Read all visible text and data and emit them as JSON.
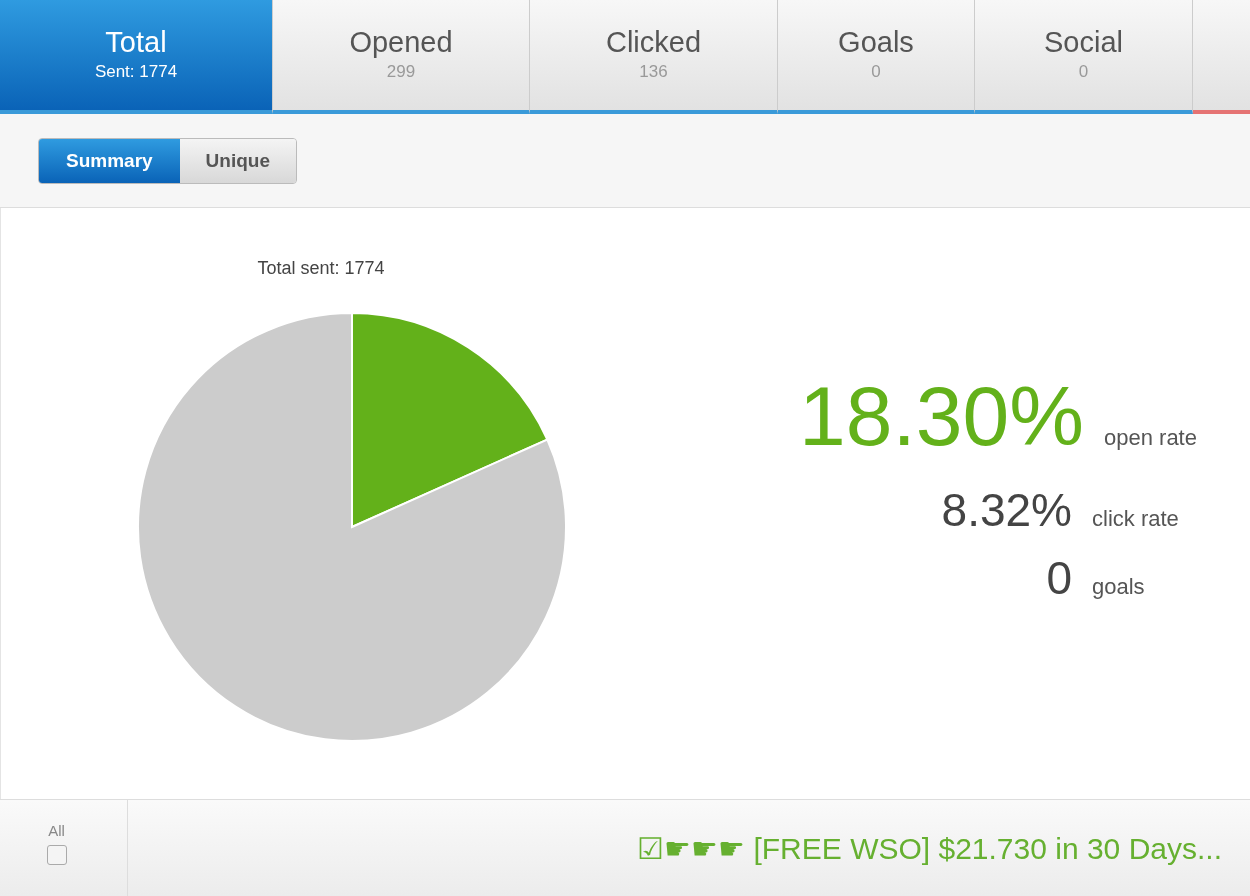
{
  "tabs": [
    {
      "label": "Total",
      "count": "Sent: 1774",
      "selected": true,
      "color": "#3a9ad9"
    },
    {
      "label": "Opened",
      "count": "299",
      "selected": false,
      "color": "#3a9ad9"
    },
    {
      "label": "Clicked",
      "count": "136",
      "selected": false,
      "color": "#3a9ad9"
    },
    {
      "label": "Goals",
      "count": "0",
      "selected": false,
      "color": "#3a9ad9"
    },
    {
      "label": "Social",
      "count": "0",
      "selected": false,
      "color": "#3a9ad9"
    },
    {
      "selected": false,
      "color": "#e57373"
    }
  ],
  "view_toggle": [
    {
      "label": "Summary",
      "selected": true
    },
    {
      "label": "Unique",
      "selected": false
    }
  ],
  "chart": {
    "chart_data": {
      "type": "pie",
      "title": "Total sent: 1774",
      "values": [
        18.3,
        81.7
      ],
      "colors": [
        "#63b11a",
        "#cccccc"
      ]
    }
  },
  "stats": [
    {
      "value": "18.30%",
      "label": "open rate",
      "kind": "primary"
    },
    {
      "value": "8.32%",
      "label": "click rate",
      "kind": "secondary"
    },
    {
      "value": "0",
      "label": "goals",
      "kind": "secondary"
    }
  ],
  "footer": {
    "select_all": {
      "label": "All",
      "checked": false
    },
    "subject": "☑☛☛☛ [FREE WSO] $21.730 in 30 Days..."
  }
}
